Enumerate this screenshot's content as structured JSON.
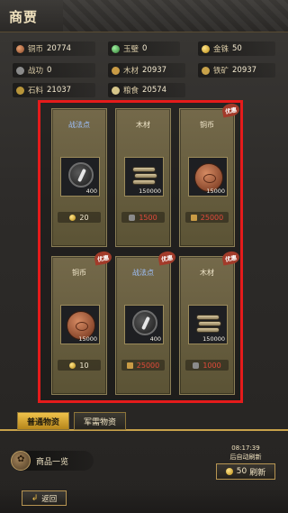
{
  "header": {
    "title": "商贾"
  },
  "resources": [
    {
      "icon": "copper-coin-icon",
      "label": "铜币",
      "value": "20774"
    },
    {
      "icon": "jade-icon",
      "label": "玉璧",
      "value": "0"
    },
    {
      "icon": "gold-icon",
      "label": "金铢",
      "value": "50"
    },
    {
      "icon": "merit-icon",
      "label": "战功",
      "value": "0"
    },
    {
      "icon": "wood-icon",
      "label": "木材",
      "value": "20937"
    },
    {
      "icon": "iron-icon",
      "label": "铁矿",
      "value": "20937"
    },
    {
      "icon": "stone-icon",
      "label": "石料",
      "value": "21037"
    },
    {
      "icon": "grain-icon",
      "label": "粮食",
      "value": "20574"
    }
  ],
  "items": [
    {
      "name": "战法点",
      "name_color": "blue",
      "visual": "scroll",
      "qty": "400",
      "deal": "",
      "price": "20",
      "price_icon": "gold",
      "price_color": "white"
    },
    {
      "name": "木材",
      "name_color": "white",
      "visual": "wood",
      "qty": "150000",
      "deal": "",
      "price": "1500",
      "price_icon": "merit",
      "price_color": "red"
    },
    {
      "name": "铜币",
      "name_color": "white",
      "visual": "coin",
      "qty": "15000",
      "deal": "优惠",
      "price": "25000",
      "price_icon": "wood",
      "price_color": "red"
    },
    {
      "name": "铜币",
      "name_color": "white",
      "visual": "coin",
      "qty": "15000",
      "deal": "优惠",
      "price": "10",
      "price_icon": "gold",
      "price_color": "white"
    },
    {
      "name": "战法点",
      "name_color": "blue",
      "visual": "scroll",
      "qty": "400",
      "deal": "优惠",
      "price": "25000",
      "price_icon": "wood",
      "price_color": "red"
    },
    {
      "name": "木材",
      "name_color": "white",
      "visual": "wood",
      "qty": "150000",
      "deal": "优惠",
      "price": "1000",
      "price_icon": "merit",
      "price_color": "red"
    }
  ],
  "tabs": [
    {
      "label": "普通物资",
      "active": true
    },
    {
      "label": "军需物资",
      "active": false
    }
  ],
  "footer": {
    "catalog_label": "商品一览",
    "timer": "08:17:39",
    "auto_refresh": "后自动刷新",
    "refresh_cost": "50",
    "refresh_label": "刷新",
    "back_label": "返回"
  },
  "colors": {
    "accent": "#c8a24a",
    "highlight_frame": "#e51b1b",
    "price_red": "#e24a3a",
    "name_blue": "#9fc2ff"
  }
}
